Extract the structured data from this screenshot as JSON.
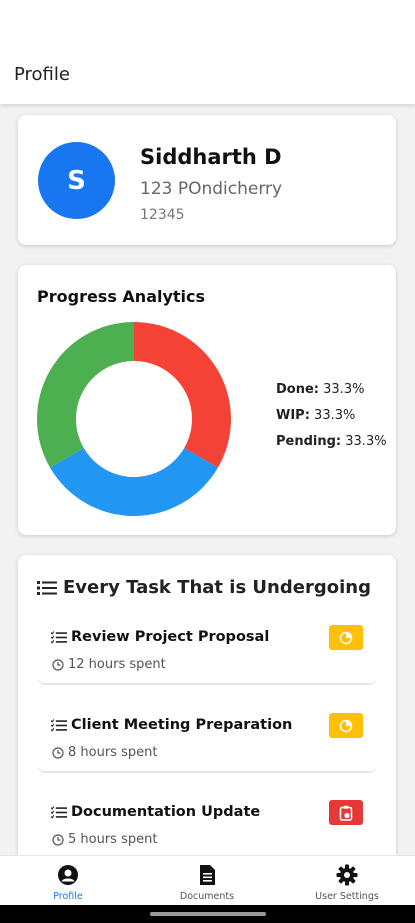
{
  "appbar": {
    "title": "Profile"
  },
  "profile": {
    "avatar_letter": "S",
    "name": "Siddharth D",
    "address": "123 POndicherry",
    "zip": "12345"
  },
  "analytics": {
    "title": "Progress Analytics",
    "legend": [
      {
        "label": "Done:",
        "value": "33.3%"
      },
      {
        "label": "WIP:",
        "value": "33.3%"
      },
      {
        "label": "Pending:",
        "value": "33.3%"
      }
    ]
  },
  "chart_data": {
    "type": "pie",
    "donut": true,
    "categories": [
      "Done",
      "WIP",
      "Pending"
    ],
    "values": [
      33.3,
      33.3,
      33.3
    ],
    "colors": [
      "#f44336",
      "#2196f3",
      "#4caf50"
    ]
  },
  "tasks": {
    "heading": "Every Task That is Undergoing",
    "items": [
      {
        "title": "Review Project Proposal",
        "meta": "12 hours spent",
        "status_icon": "in-progress-icon",
        "status_color": "#ffc107"
      },
      {
        "title": "Client Meeting Preparation",
        "meta": "8 hours spent",
        "status_icon": "in-progress-icon",
        "status_color": "#ffc107"
      },
      {
        "title": "Documentation Update",
        "meta": "5 hours spent",
        "status_icon": "pending-clipboard-icon",
        "status_color": "#e53935"
      }
    ]
  },
  "nav": {
    "items": [
      {
        "label": "Profile",
        "icon": "profile-icon"
      },
      {
        "label": "Documents",
        "icon": "documents-icon"
      },
      {
        "label": "User Settings",
        "icon": "settings-gear-icon"
      }
    ],
    "active_color": "#1776f0"
  }
}
